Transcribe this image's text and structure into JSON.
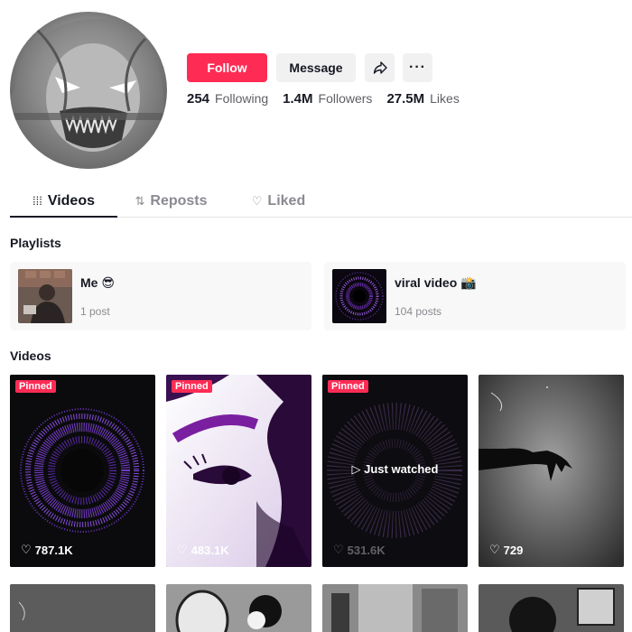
{
  "profile": {
    "follow_label": "Follow",
    "message_label": "Message",
    "share_icon": "share-arrow-icon",
    "more_icon": "more-dots-icon",
    "more_glyph": "···",
    "stats": {
      "following_count": "254",
      "following_label": "Following",
      "followers_count": "1.4M",
      "followers_label": "Followers",
      "likes_count": "27.5M",
      "likes_label": "Likes"
    }
  },
  "tabs": [
    {
      "label": "Videos",
      "icon": "grid-icon",
      "glyph": "⁞⁞⁞",
      "active": true
    },
    {
      "label": "Reposts",
      "icon": "repost-icon",
      "glyph": "⇅",
      "active": false
    },
    {
      "label": "Liked",
      "icon": "heart-lock-icon",
      "glyph": "♡",
      "active": false
    }
  ],
  "playlists_title": "Playlists",
  "playlists": [
    {
      "name": "Me 😎",
      "count": "1 post"
    },
    {
      "name": "viral video 📸",
      "count": "104 posts"
    }
  ],
  "videos_title": "Videos",
  "videos": [
    {
      "pinned": "Pinned",
      "likes": "787.1K"
    },
    {
      "pinned": "Pinned",
      "likes": "483.1K"
    },
    {
      "pinned": "Pinned",
      "likes": "531.6K",
      "overlay": "Just watched"
    },
    {
      "likes": "729"
    }
  ],
  "colors": {
    "accent": "#fe2c55",
    "button_bg": "#f1f1f2",
    "text_primary": "#161823",
    "text_secondary": "#8a8b91"
  }
}
